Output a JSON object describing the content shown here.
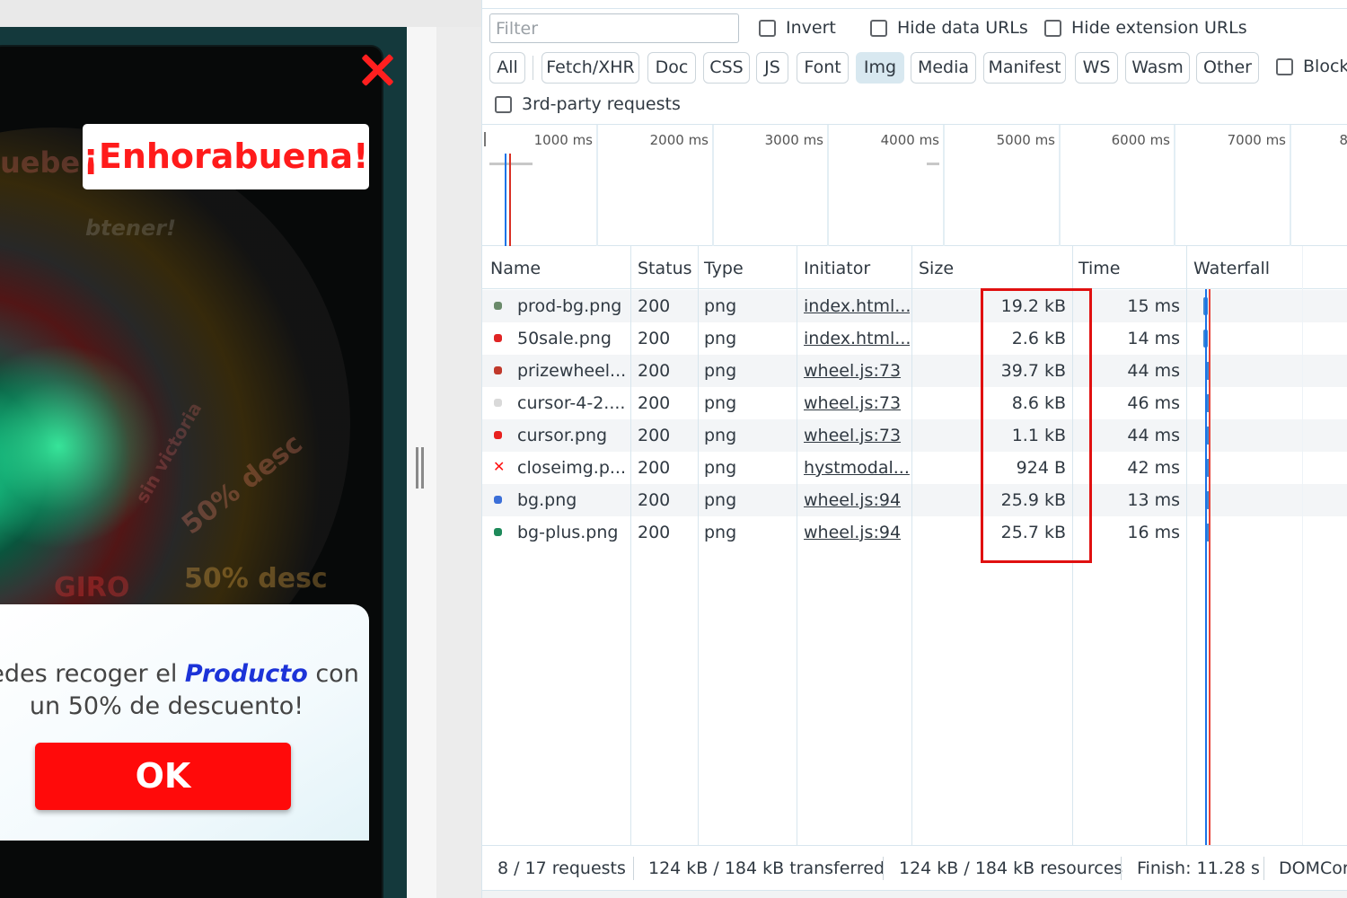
{
  "popup": {
    "title": "¡Enhorabuena!",
    "ghost_text_top": "uebe s",
    "ghost_text_sub": "btener!",
    "ghost_wheel_1": "50% desc",
    "ghost_wheel_2": "50% desc",
    "ghost_wheel_3": "GIRO",
    "ghost_wheel_4": "sin victoria",
    "message_prefix": "uedes recoger el ",
    "message_highlight": "Producto",
    "message_suffix": " con",
    "message_line2": "un 50% de descuento!",
    "ok_label": "OK"
  },
  "devtools": {
    "filter": {
      "placeholder": "Filter",
      "value": ""
    },
    "checkboxes": {
      "invert": "Invert",
      "hide_data_urls": "Hide data URLs",
      "hide_extension_urls": "Hide extension URLs",
      "block": "Block",
      "third_party": "3rd-party requests"
    },
    "type_filters": [
      "All",
      "Fetch/XHR",
      "Doc",
      "CSS",
      "JS",
      "Font",
      "Img",
      "Media",
      "Manifest",
      "WS",
      "Wasm",
      "Other"
    ],
    "active_type_filter": "Img",
    "overview_ticks": [
      "1000 ms",
      "2000 ms",
      "3000 ms",
      "4000 ms",
      "5000 ms",
      "6000 ms",
      "7000 ms",
      "8"
    ],
    "columns": [
      "Name",
      "Status",
      "Type",
      "Initiator",
      "Size",
      "Time",
      "Waterfall"
    ],
    "rows": [
      {
        "name": "prod-bg.png",
        "status": "200",
        "type": "png",
        "initiator": "index.html...",
        "size": "19.2 kB",
        "time": "15 ms",
        "icon": "image-thumb-icon",
        "icon_color": "#6a8a6a"
      },
      {
        "name": "50sale.png",
        "status": "200",
        "type": "png",
        "initiator": "index.html...",
        "size": "2.6 kB",
        "time": "14 ms",
        "icon": "image-thumb-icon",
        "icon_color": "#e02424"
      },
      {
        "name": "prizewheel...",
        "status": "200",
        "type": "png",
        "initiator": "wheel.js:73",
        "size": "39.7 kB",
        "time": "44 ms",
        "icon": "image-thumb-icon",
        "icon_color": "#c0392b"
      },
      {
        "name": "cursor-4-2....",
        "status": "200",
        "type": "png",
        "initiator": "wheel.js:73",
        "size": "8.6 kB",
        "time": "46 ms",
        "icon": "image-thumb-icon",
        "icon_color": "#d9d9d9"
      },
      {
        "name": "cursor.png",
        "status": "200",
        "type": "png",
        "initiator": "wheel.js:73",
        "size": "1.1 kB",
        "time": "44 ms",
        "icon": "image-thumb-icon",
        "icon_color": "#e8201e"
      },
      {
        "name": "closeimg.p...",
        "status": "200",
        "type": "png",
        "initiator": "hystmodal...",
        "size": "924 B",
        "time": "42 ms",
        "icon": "close-thumb-icon",
        "icon_color": "#ff1010"
      },
      {
        "name": "bg.png",
        "status": "200",
        "type": "png",
        "initiator": "wheel.js:94",
        "size": "25.9 kB",
        "time": "13 ms",
        "icon": "image-thumb-icon",
        "icon_color": "#3b6fd8"
      },
      {
        "name": "bg-plus.png",
        "status": "200",
        "type": "png",
        "initiator": "wheel.js:94",
        "size": "25.7 kB",
        "time": "16 ms",
        "icon": "image-thumb-icon",
        "icon_color": "#1e8a5a"
      }
    ],
    "status_bar": {
      "requests": "8 / 17 requests",
      "transferred": "124 kB / 184 kB transferred",
      "resources": "124 kB / 184 kB resources",
      "finish": "Finish: 11.28 s",
      "domcontent": "DOMCor"
    },
    "highlight_color": "#e01010"
  }
}
